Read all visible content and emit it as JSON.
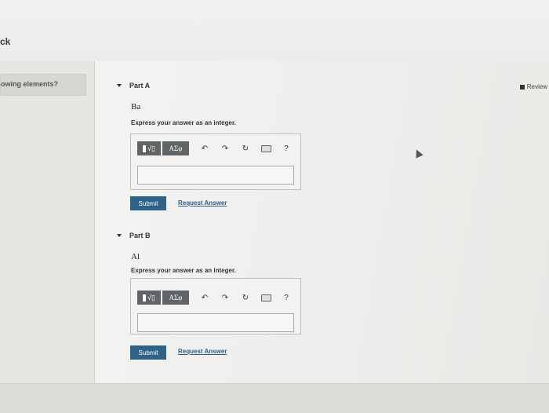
{
  "header": {
    "back_text": "ck"
  },
  "sidebar": {
    "item_label": "owing elements?"
  },
  "review": {
    "label": "Review"
  },
  "parts": [
    {
      "title": "Part A",
      "element": "Ba",
      "instruction": "Express your answer as an integer.",
      "symbols_label": "ΑΣφ",
      "help_label": "?",
      "submit_label": "Submit",
      "request_label": "Request Answer",
      "answer_value": ""
    },
    {
      "title": "Part B",
      "element": "Al",
      "instruction": "Express your answer as an integer.",
      "symbols_label": "ΑΣφ",
      "help_label": "?",
      "submit_label": "Submit",
      "request_label": "Request Answer",
      "answer_value": ""
    }
  ],
  "colors": {
    "submit_bg": "#2f6287",
    "toolbar_dark": "#5f6466",
    "link": "#2f5f85"
  }
}
